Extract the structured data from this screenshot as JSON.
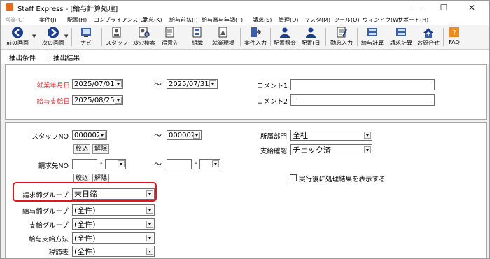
{
  "window": {
    "title": "Staff Express - [給与計算処理]",
    "controls": [
      "—",
      "☐",
      "✕"
    ]
  },
  "menu": [
    {
      "label": "営業(G)",
      "enabled": false
    },
    {
      "label": "案件(J)",
      "enabled": true
    },
    {
      "label": "配置(H)",
      "enabled": true
    },
    {
      "label": "コンプライアンス(C)",
      "enabled": true
    },
    {
      "label": "勤怠(K)",
      "enabled": true
    },
    {
      "label": "給与前払(I)",
      "enabled": true
    },
    {
      "label": "給与賞与年調(T)",
      "enabled": true
    },
    {
      "label": "請求(S)",
      "enabled": true
    },
    {
      "label": "管理(D)",
      "enabled": true
    },
    {
      "label": "マスタ(M)",
      "enabled": true
    },
    {
      "label": "ツール(O)",
      "enabled": true
    },
    {
      "label": "ウィンドウ(W)",
      "enabled": true
    },
    {
      "label": "サポート(H)",
      "enabled": true
    }
  ],
  "toolbar": {
    "prev": "前の画面",
    "next": "次の画面",
    "navi": "ナビ",
    "staff": "スタッフ",
    "staff_search": "ｽﾀｯﾌ検索",
    "client": "得意先",
    "org": "組織",
    "workplace": "就業現場",
    "case_entry": "案件入力",
    "assign_inquiry": "配置照会",
    "assign": "配置(日",
    "attendance": "勤怠入力",
    "payroll": "給与計算",
    "billing": "請求計算",
    "contact": "お問合せ",
    "faq": "FAQ"
  },
  "tabs": {
    "conditions": "抽出条件",
    "results": "抽出結果"
  },
  "form": {
    "work_month_label": "就業年月日",
    "work_from": "2025/07/01",
    "work_to": "2025/07/31",
    "pay_date_label": "給与支給日",
    "pay_date": "2025/08/25",
    "comment1_label": "コメント1",
    "comment2_label": "コメント2",
    "tilde": "〜",
    "staff_no_label": "スタッフNO",
    "staff_from": "000002",
    "staff_to": "000002",
    "narrow": "絞込",
    "clear": "解除",
    "client_no_label": "請求先NO",
    "dept_label": "所属部門",
    "dept_value": "全社",
    "pay_confirm_label": "支給確認",
    "pay_confirm_value": "チェック済",
    "show_result_label": "実行後に処理結果を表示する",
    "billing_group_label": "請求締グループ",
    "billing_group_value": "末日締",
    "salary_group_label": "給与締グループ",
    "salary_group_value": "(全件)",
    "payment_group_label": "支給グループ",
    "payment_group_value": "(全件)",
    "payment_method_label": "給与支給方法",
    "payment_method_value": "(全件)",
    "tax_table_label": "税額表",
    "tax_table_value": "(全件)"
  }
}
